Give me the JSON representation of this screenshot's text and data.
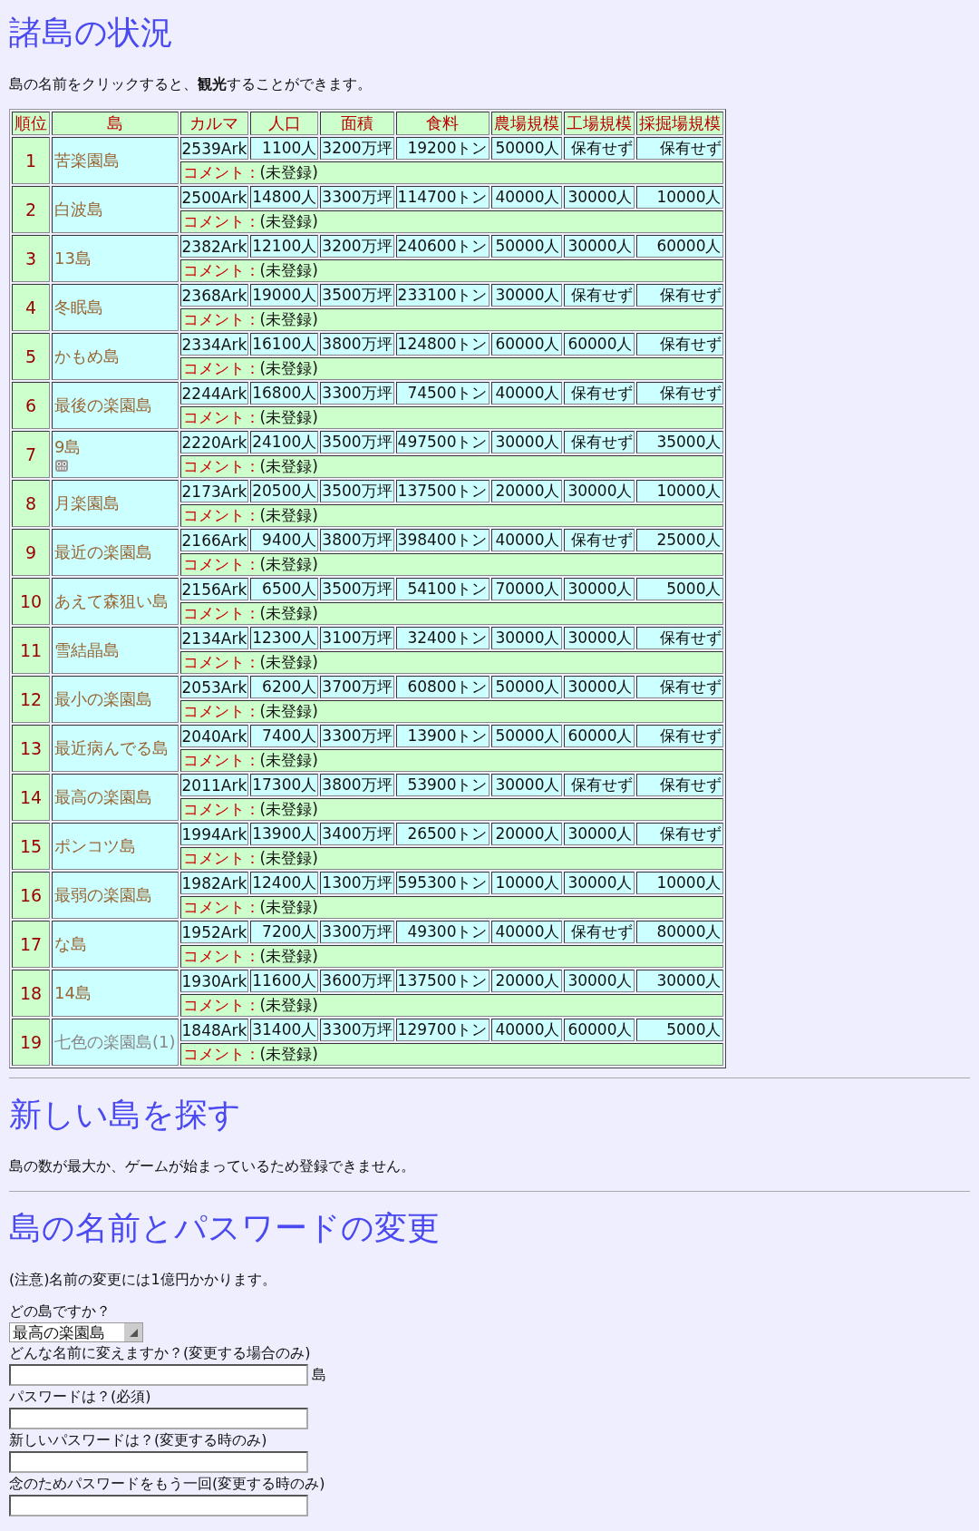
{
  "status_section": {
    "heading": "諸島の状況",
    "intro": "島の名前をクリックすると、**観光**することができます。",
    "table": {
      "columns": [
        "順位",
        "島",
        "カルマ",
        "人口",
        "面積",
        "食料",
        "農場規模",
        "工場規模",
        "採掘場規模"
      ],
      "rows": [
        {
          "rank": "1",
          "name": "苦楽園島",
          "badge": false,
          "inactive": false,
          "karma": "2539Ark",
          "population": "1100人",
          "area": "3200万坪",
          "food": "19200トン",
          "farm": "50000人",
          "factory": "保有せず",
          "mine": "保有せず",
          "comment_label": "コメント：",
          "comment": "(未登録)"
        },
        {
          "rank": "2",
          "name": "白波島",
          "badge": false,
          "inactive": false,
          "karma": "2500Ark",
          "population": "14800人",
          "area": "3300万坪",
          "food": "114700トン",
          "farm": "40000人",
          "factory": "30000人",
          "mine": "10000人",
          "comment_label": "コメント：",
          "comment": "(未登録)"
        },
        {
          "rank": "3",
          "name": "13島",
          "badge": false,
          "inactive": false,
          "karma": "2382Ark",
          "population": "12100人",
          "area": "3200万坪",
          "food": "240600トン",
          "farm": "50000人",
          "factory": "30000人",
          "mine": "60000人",
          "comment_label": "コメント：",
          "comment": "(未登録)"
        },
        {
          "rank": "4",
          "name": "冬眠島",
          "badge": false,
          "inactive": false,
          "karma": "2368Ark",
          "population": "19000人",
          "area": "3500万坪",
          "food": "233100トン",
          "farm": "30000人",
          "factory": "保有せず",
          "mine": "保有せず",
          "comment_label": "コメント：",
          "comment": "(未登録)"
        },
        {
          "rank": "5",
          "name": "かもめ島",
          "badge": false,
          "inactive": false,
          "karma": "2334Ark",
          "population": "16100人",
          "area": "3800万坪",
          "food": "124800トン",
          "farm": "60000人",
          "factory": "60000人",
          "mine": "保有せず",
          "comment_label": "コメント：",
          "comment": "(未登録)"
        },
        {
          "rank": "6",
          "name": "最後の楽園島",
          "badge": false,
          "inactive": false,
          "karma": "2244Ark",
          "population": "16800人",
          "area": "3300万坪",
          "food": "74500トン",
          "farm": "40000人",
          "factory": "保有せず",
          "mine": "保有せず",
          "comment_label": "コメント：",
          "comment": "(未登録)"
        },
        {
          "rank": "7",
          "name": "9島",
          "badge": true,
          "inactive": false,
          "karma": "2220Ark",
          "population": "24100人",
          "area": "3500万坪",
          "food": "497500トン",
          "farm": "30000人",
          "factory": "保有せず",
          "mine": "35000人",
          "comment_label": "コメント：",
          "comment": "(未登録)"
        },
        {
          "rank": "8",
          "name": "月楽園島",
          "badge": false,
          "inactive": false,
          "karma": "2173Ark",
          "population": "20500人",
          "area": "3500万坪",
          "food": "137500トン",
          "farm": "20000人",
          "factory": "30000人",
          "mine": "10000人",
          "comment_label": "コメント：",
          "comment": "(未登録)"
        },
        {
          "rank": "9",
          "name": "最近の楽園島",
          "badge": false,
          "inactive": false,
          "karma": "2166Ark",
          "population": "9400人",
          "area": "3800万坪",
          "food": "398400トン",
          "farm": "40000人",
          "factory": "保有せず",
          "mine": "25000人",
          "comment_label": "コメント：",
          "comment": "(未登録)"
        },
        {
          "rank": "10",
          "name": "あえて森狙い島",
          "badge": false,
          "inactive": false,
          "karma": "2156Ark",
          "population": "6500人",
          "area": "3500万坪",
          "food": "54100トン",
          "farm": "70000人",
          "factory": "30000人",
          "mine": "5000人",
          "comment_label": "コメント：",
          "comment": "(未登録)"
        },
        {
          "rank": "11",
          "name": "雪結晶島",
          "badge": false,
          "inactive": false,
          "karma": "2134Ark",
          "population": "12300人",
          "area": "3100万坪",
          "food": "32400トン",
          "farm": "30000人",
          "factory": "30000人",
          "mine": "保有せず",
          "comment_label": "コメント：",
          "comment": "(未登録)"
        },
        {
          "rank": "12",
          "name": "最小の楽園島",
          "badge": false,
          "inactive": false,
          "karma": "2053Ark",
          "population": "6200人",
          "area": "3700万坪",
          "food": "60800トン",
          "farm": "50000人",
          "factory": "30000人",
          "mine": "保有せず",
          "comment_label": "コメント：",
          "comment": "(未登録)"
        },
        {
          "rank": "13",
          "name": "最近病んでる島",
          "badge": false,
          "inactive": false,
          "karma": "2040Ark",
          "population": "7400人",
          "area": "3300万坪",
          "food": "13900トン",
          "farm": "50000人",
          "factory": "60000人",
          "mine": "保有せず",
          "comment_label": "コメント：",
          "comment": "(未登録)"
        },
        {
          "rank": "14",
          "name": "最高の楽園島",
          "badge": false,
          "inactive": false,
          "karma": "2011Ark",
          "population": "17300人",
          "area": "3800万坪",
          "food": "53900トン",
          "farm": "30000人",
          "factory": "保有せず",
          "mine": "保有せず",
          "comment_label": "コメント：",
          "comment": "(未登録)"
        },
        {
          "rank": "15",
          "name": "ポンコツ島",
          "badge": false,
          "inactive": false,
          "karma": "1994Ark",
          "population": "13900人",
          "area": "3400万坪",
          "food": "26500トン",
          "farm": "20000人",
          "factory": "30000人",
          "mine": "保有せず",
          "comment_label": "コメント：",
          "comment": "(未登録)"
        },
        {
          "rank": "16",
          "name": "最弱の楽園島",
          "badge": false,
          "inactive": false,
          "karma": "1982Ark",
          "population": "12400人",
          "area": "1300万坪",
          "food": "595300トン",
          "farm": "10000人",
          "factory": "30000人",
          "mine": "10000人",
          "comment_label": "コメント：",
          "comment": "(未登録)"
        },
        {
          "rank": "17",
          "name": "な島",
          "badge": false,
          "inactive": false,
          "karma": "1952Ark",
          "population": "7200人",
          "area": "3300万坪",
          "food": "49300トン",
          "farm": "40000人",
          "factory": "保有せず",
          "mine": "80000人",
          "comment_label": "コメント：",
          "comment": "(未登録)"
        },
        {
          "rank": "18",
          "name": "14島",
          "badge": false,
          "inactive": false,
          "karma": "1930Ark",
          "population": "11600人",
          "area": "3600万坪",
          "food": "137500トン",
          "farm": "20000人",
          "factory": "30000人",
          "mine": "30000人",
          "comment_label": "コメント：",
          "comment": "(未登録)"
        },
        {
          "rank": "19",
          "name": "七色の楽園島(1)",
          "badge": false,
          "inactive": true,
          "karma": "1848Ark",
          "population": "31400人",
          "area": "3300万坪",
          "food": "129700トン",
          "farm": "40000人",
          "factory": "60000人",
          "mine": "5000人",
          "comment_label": "コメント：",
          "comment": "(未登録)"
        }
      ]
    }
  },
  "new_island": {
    "heading": "新しい島を探す",
    "message": "島の数が最大か、ゲームが始まっているため登録できません。"
  },
  "change_form": {
    "heading": "島の名前とパスワードの変更",
    "note": "(注意)名前の変更には1億円かかります。",
    "fields": [
      {
        "kind": "select",
        "label": "どの島ですか？",
        "value": "最高の楽園島"
      },
      {
        "kind": "text",
        "label": "どんな名前に変えますか？(変更する場合のみ)",
        "suffix": "島"
      },
      {
        "kind": "text",
        "label": "パスワードは？(必須)"
      },
      {
        "kind": "text",
        "label": "新しいパスワードは？(変更する時のみ)"
      },
      {
        "kind": "text",
        "label": "念のためパスワードをもう一回(変更する時のみ)"
      }
    ]
  }
}
